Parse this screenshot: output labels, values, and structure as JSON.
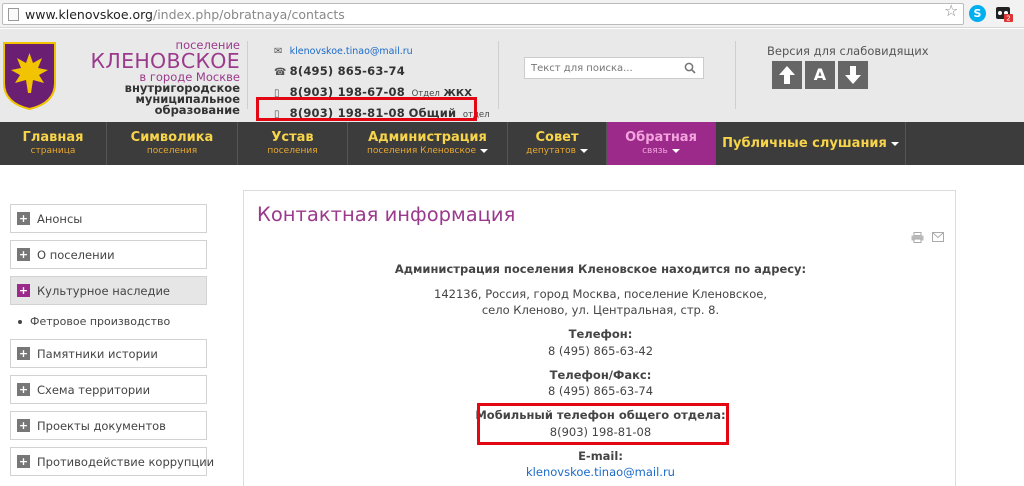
{
  "browser": {
    "url_host": "www.klenovskoe.org",
    "url_path": "/index.php/obratnaya/contacts"
  },
  "header": {
    "brand_line1": "поселение",
    "brand_line2": "КЛЕНОВСКОЕ",
    "brand_line3": "в городе Москве",
    "brand_line4": "внутригородское",
    "brand_line5": "муниципальное",
    "brand_line6": "образование",
    "email": "klenovskoe.tinao@mail.ru",
    "phone1": "8(495) 865-63-74",
    "phone2": "8(903) 198-67-08",
    "phone2_dept1": "Отдел",
    "phone2_dept2": "ЖКХ",
    "phone3": "8(903) 198-81-08",
    "phone3_dept1": "Общий",
    "phone3_dept2": "отдел",
    "search_placeholder": "Текст для поиска...",
    "accessibility_label": "Версия для слабовидящих",
    "acc_font_label": "A"
  },
  "nav": [
    {
      "title": "Главная",
      "sub": "страница"
    },
    {
      "title": "Символика",
      "sub": "поселения"
    },
    {
      "title": "Устав",
      "sub": "поселения"
    },
    {
      "title": "Администрация",
      "sub": "поселения Кленовское"
    },
    {
      "title": "Совет",
      "sub": "депутатов"
    },
    {
      "title": "Обратная",
      "sub": "связь"
    },
    {
      "title": "Публичные слушания",
      "sub": ""
    }
  ],
  "sidebar": {
    "items": [
      {
        "label": "Анонсы"
      },
      {
        "label": "О поселении"
      },
      {
        "label": "Культурное наследие"
      },
      {
        "label": "Памятники истории"
      },
      {
        "label": "Схема территории"
      },
      {
        "label": "Проекты документов"
      },
      {
        "label": "Противодействие коррупции"
      }
    ],
    "sub_item": "Фетровое производство"
  },
  "main": {
    "title": "Контактная информация",
    "address_heading": "Администрация поселения Кленовское находится по адресу:",
    "address_line1": "142136, Россия, город Москва, поселение Кленовское,",
    "address_line2": "село Кленово, ул. Центральная, стр. 8.",
    "phone_heading": "Телефон:",
    "phone_value": "8 (495) 865-63-42",
    "fax_heading": "Телефон/Факс:",
    "fax_value": "8 (495) 865-63-74",
    "mobile_heading": "Мобильный телефон общего отдела:",
    "mobile_value": "8(903) 198-81-08",
    "email_heading": "E-mail:",
    "email_value": "klenovskoe.tinao@mail.ru"
  },
  "colors": {
    "brand_purple": "#9b3a8c",
    "nav_bg": "#3c3c3c",
    "nav_text": "#f7d44a",
    "highlight_red": "#e30613"
  }
}
